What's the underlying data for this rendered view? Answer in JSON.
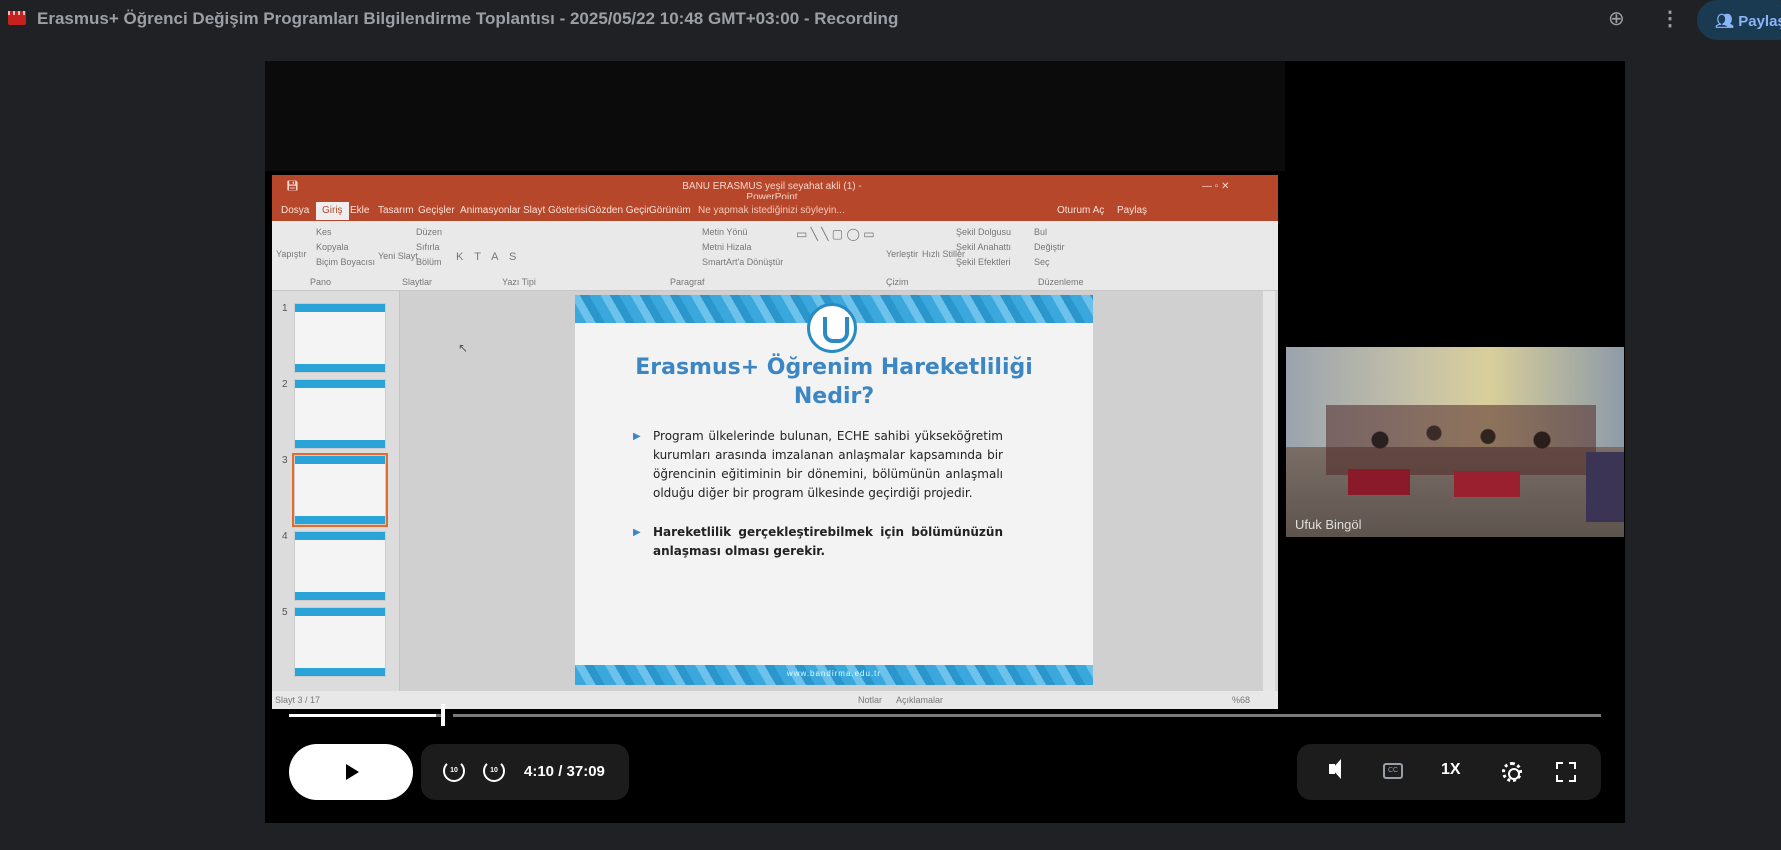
{
  "window": {
    "title": "Erasmus+ Öğrenci Değişim Programları Bilgilendirme Toplantısı - 2025/05/22 10:48 GMT+03:00 - Recording",
    "share_label": "Paylaş"
  },
  "ppt": {
    "title": "BANU ERASMUS yeşil seyahat akli (1) - PowerPoint",
    "menu": [
      "Dosya",
      "Giriş",
      "Ekle",
      "Tasarım",
      "Geçişler",
      "Animasyonlar",
      "Slayt Gösterisi",
      "Gözden Geçir",
      "Görünüm"
    ],
    "search_hint": "Ne yapmak istediğinizi söyleyin...",
    "signin": "Oturum Aç",
    "share": "Paylaş",
    "ribbon": {
      "clipboard": "Pano",
      "paste": "Yapıştır",
      "cut": "Kes",
      "copy": "Kopyala",
      "format_painter": "Biçim Boyacısı",
      "slides": "Slaytlar",
      "new_slide": "Yeni Slayt",
      "layout": "Düzen",
      "reset": "Sıfırla",
      "section": "Bölüm",
      "font": "Yazı Tipi",
      "paragraph": "Paragraf",
      "text_direction": "Metin Yönü",
      "align_text": "Metni Hizala",
      "smartart": "SmartArt'a Dönüştür",
      "drawing": "Çizim",
      "arrange": "Yerleştir",
      "quick_styles": "Hızlı Stiller",
      "shape_fill": "Şekil Dolgusu",
      "shape_outline": "Şekil Anahattı",
      "shape_effects": "Şekil Efektleri",
      "editing": "Düzenleme",
      "find": "Bul",
      "replace": "Değiştir",
      "select": "Seç"
    },
    "thumbs": [
      "1",
      "2",
      "3",
      "4",
      "5"
    ],
    "slide": {
      "title_line1": "Erasmus+ Öğrenim Hareketliliği",
      "title_line2": "Nedir?",
      "bullet1": "Program ülkelerinde bulunan, ECHE sahibi yükseköğretim kurumları arasında imzalanan anlaşmalar kapsamında bir öğrencinin eğitiminin bir dönemini, bölümünün anlaşmalı olduğu diğer bir program ülkesinde geçirdiği projedir.",
      "bullet2": "Hareketlilik gerçekleştirebilmek için bölümünüzün anlaşması olması gerekir.",
      "url": "www.bandirma.edu.tr"
    },
    "status": {
      "slide_info": "Slayt 3 / 17",
      "notes": "Notlar",
      "comments": "Açıklamalar",
      "zoom": "%68"
    }
  },
  "camera": {
    "name": "Ufuk Bingöl"
  },
  "player": {
    "current_time": "4:10",
    "duration": "/ 37:09",
    "progress_fraction": 0.112,
    "speed": "1X",
    "skip_back": "10",
    "skip_forward": "10",
    "cc": "CC"
  }
}
